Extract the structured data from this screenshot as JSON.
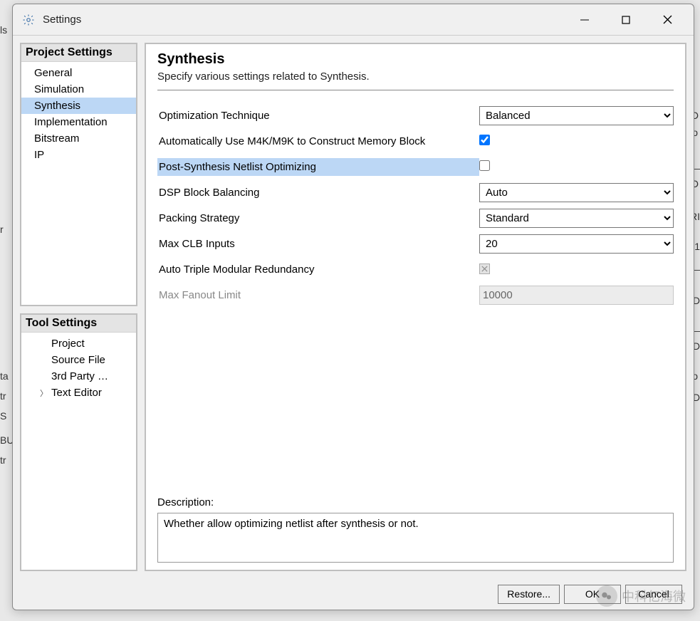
{
  "window": {
    "title": "Settings",
    "icon": "gear-icon"
  },
  "sidebar": {
    "project": {
      "header": "Project Settings",
      "items": [
        {
          "label": "General",
          "selected": false
        },
        {
          "label": "Simulation",
          "selected": false
        },
        {
          "label": "Synthesis",
          "selected": true
        },
        {
          "label": "Implementation",
          "selected": false
        },
        {
          "label": "Bitstream",
          "selected": false
        },
        {
          "label": "IP",
          "selected": false
        }
      ]
    },
    "tool": {
      "header": "Tool Settings",
      "items": [
        {
          "label": "Project",
          "selected": false
        },
        {
          "label": "Source File",
          "selected": false
        },
        {
          "label": "3rd Party …",
          "selected": false
        },
        {
          "label": "Text Editor",
          "selected": false,
          "expandable": true
        }
      ]
    }
  },
  "main": {
    "title": "Synthesis",
    "subtitle": "Specify various settings related to Synthesis.",
    "settings": [
      {
        "key": "opt_tech",
        "label": "Optimization Technique",
        "type": "select",
        "value": "Balanced"
      },
      {
        "key": "auto_m4k",
        "label": "Automatically Use M4K/M9K to Construct Memory Block",
        "type": "checkbox",
        "checked": true
      },
      {
        "key": "post_opt",
        "label": "Post-Synthesis Netlist Optimizing",
        "type": "checkbox",
        "checked": false,
        "selected": true
      },
      {
        "key": "dsp_bal",
        "label": "DSP Block Balancing",
        "type": "select",
        "value": "Auto"
      },
      {
        "key": "pack_strat",
        "label": "Packing Strategy",
        "type": "select",
        "value": "Standard"
      },
      {
        "key": "max_clb",
        "label": "Max CLB Inputs",
        "type": "select",
        "value": "20"
      },
      {
        "key": "tmr",
        "label": "Auto Triple Modular Redundancy",
        "type": "checkbox_disabled",
        "checked": true
      },
      {
        "key": "max_fanout",
        "label": "Max Fanout Limit",
        "type": "text_disabled",
        "value": "10000"
      }
    ],
    "description_label": "Description:",
    "description_text": "Whether allow optimizing netlist after synthesis or not."
  },
  "footer": {
    "restore": "Restore...",
    "ok": "OK",
    "cancel": "Cancel"
  },
  "watermark": "中科亿海微"
}
